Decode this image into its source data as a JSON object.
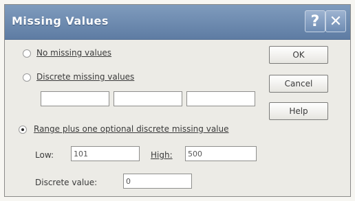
{
  "window": {
    "title": "Missing Values"
  },
  "titlebar_buttons": {
    "help": "?",
    "close": "✕"
  },
  "options": {
    "no_missing": {
      "label": "No missing values",
      "selected": false
    },
    "discrete": {
      "label": "Discrete missing values",
      "selected": false,
      "values": [
        "",
        "",
        ""
      ]
    },
    "range": {
      "label": "Range plus one optional discrete missing value",
      "selected": true
    }
  },
  "range": {
    "low_label": "Low:",
    "low_value": "101",
    "high_label": "High:",
    "high_value": "500",
    "discrete_label": "Discrete value:",
    "discrete_value": "0"
  },
  "buttons": {
    "ok": "OK",
    "cancel": "Cancel",
    "help": "Help"
  },
  "icons": [
    "help-icon",
    "close-icon"
  ]
}
